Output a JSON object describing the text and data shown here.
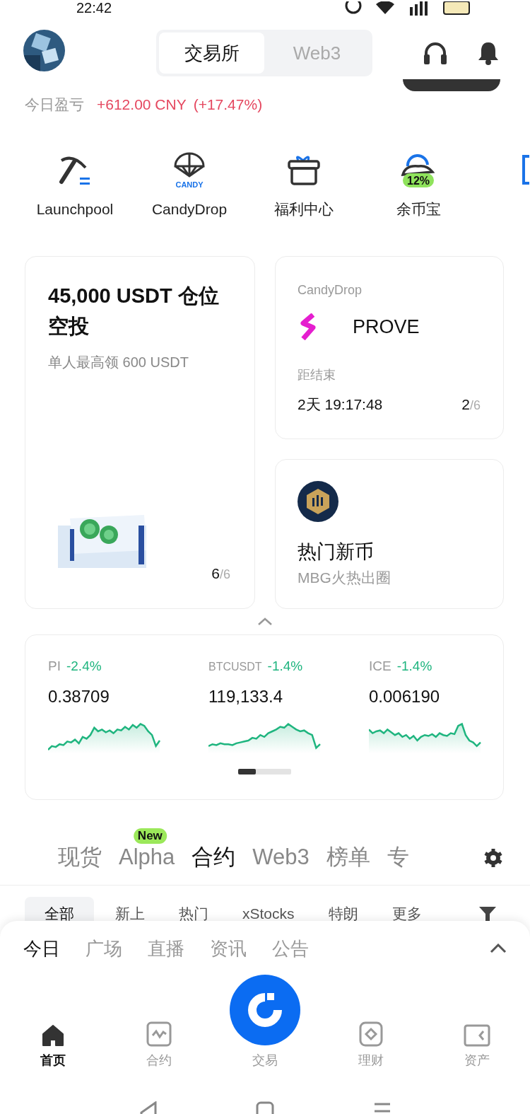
{
  "status_bar": {
    "time": "22:42"
  },
  "header": {
    "segments": [
      {
        "label": "交易所",
        "selected": true
      },
      {
        "label": "Web3",
        "selected": false
      }
    ]
  },
  "pnl": {
    "label": "今日盈亏",
    "value": "+612.00 CNY",
    "percent": "(+17.47%)"
  },
  "shortcuts": [
    {
      "kind": "launchpool",
      "label": "Launchpool"
    },
    {
      "kind": "candy",
      "label": "CandyDrop",
      "badge": "CANDY"
    },
    {
      "kind": "gift",
      "label": "福利中心"
    },
    {
      "kind": "savings",
      "label": "余币宝",
      "badge": "12%"
    },
    {
      "kind": "copy"
    }
  ],
  "promo": {
    "title": "45,000 USDT 仓位空投",
    "subtitle": "单人最高领 600 USDT",
    "page": "6",
    "total": "/6"
  },
  "candydrop": {
    "label": "CandyDrop",
    "token": "PROVE",
    "countdown_label": "距结束",
    "countdown": "2天 19:17:48",
    "page": "2",
    "total": "/6"
  },
  "hot": {
    "title": "热门新币",
    "subtitle": "MBG火热出圈"
  },
  "tickers": [
    {
      "symbol": "PI",
      "change": "-2.4%",
      "price": "0.38709"
    },
    {
      "symbol": "BTCUSDT",
      "change": "-1.4%",
      "price": "119,133.4"
    },
    {
      "symbol": "ICE",
      "change": "-1.4%",
      "price": "0.006190"
    }
  ],
  "market_tabs": [
    {
      "label": "现货",
      "selected": false
    },
    {
      "label": "Alpha",
      "selected": false,
      "badge": "New"
    },
    {
      "label": "合约",
      "selected": true
    },
    {
      "label": "Web3",
      "selected": false
    },
    {
      "label": "榜单",
      "selected": false
    },
    {
      "label": "专",
      "selected": false
    }
  ],
  "filters": [
    {
      "label": "全部",
      "selected": true
    },
    {
      "label": "新上",
      "selected": false
    },
    {
      "label": "热门",
      "selected": false
    },
    {
      "label": "xStocks",
      "selected": false
    },
    {
      "label": "特朗",
      "selected": false
    },
    {
      "label": "更多",
      "selected": false
    }
  ],
  "feed_tabs": [
    {
      "label": "今日",
      "selected": true
    },
    {
      "label": "广场",
      "selected": false
    },
    {
      "label": "直播",
      "selected": false
    },
    {
      "label": "资讯",
      "selected": false
    },
    {
      "label": "公告",
      "selected": false
    }
  ],
  "nav": [
    {
      "kind": "home",
      "label": "首页",
      "selected": true
    },
    {
      "kind": "futures",
      "label": "合约",
      "selected": false
    },
    {
      "kind": "trade",
      "label": "交易",
      "selected": false
    },
    {
      "kind": "earn",
      "label": "理财",
      "selected": false
    },
    {
      "kind": "assets",
      "label": "资产",
      "selected": false
    }
  ]
}
